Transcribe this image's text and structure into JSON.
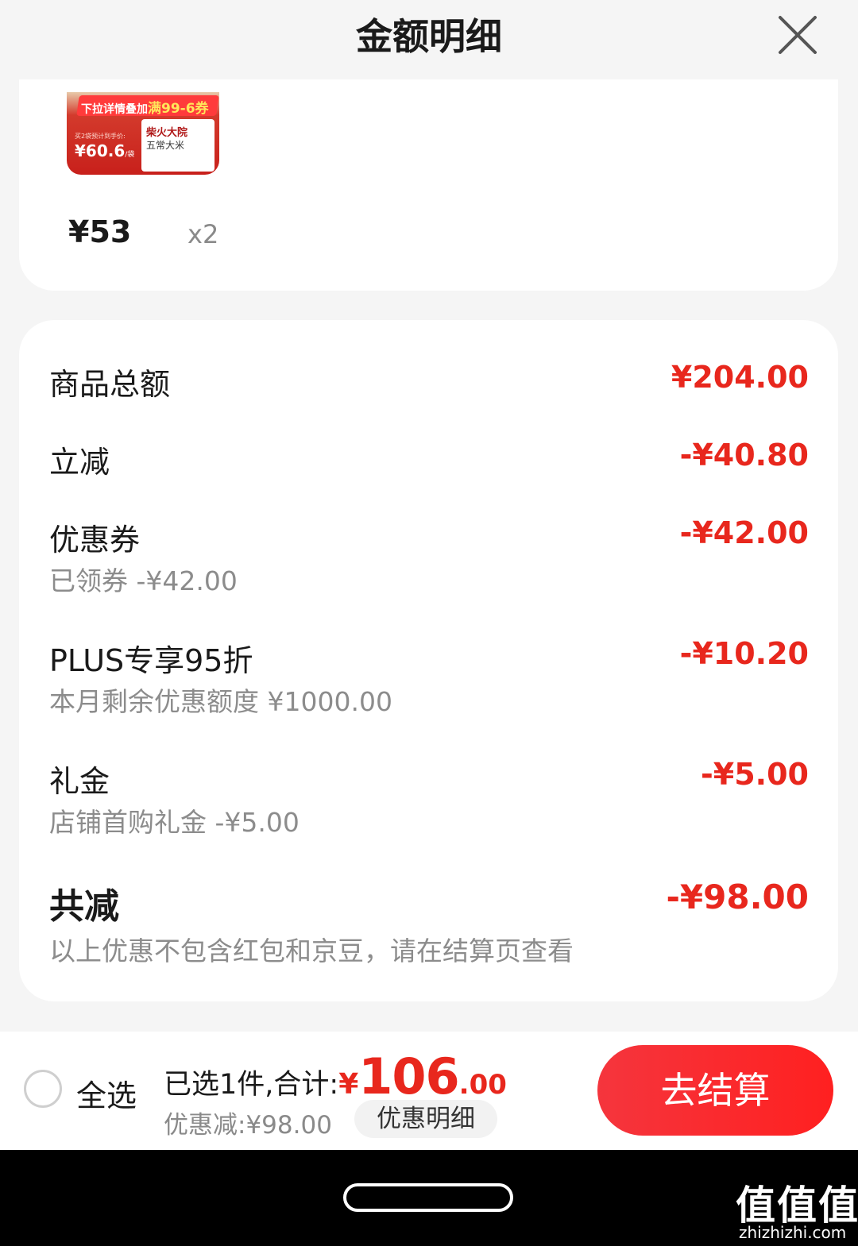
{
  "header": {
    "title": "金额明细",
    "close_icon": "close-icon"
  },
  "product": {
    "image": {
      "banner_prefix": "下拉详情叠加",
      "banner_highlight": "满99-6券",
      "box_brand": "柴火大院",
      "box_name": "五常大米",
      "small_text": "买2袋预计到手价:",
      "price_main": "¥60.6",
      "price_unit": "/袋"
    },
    "price": "¥53",
    "quantity": "x2"
  },
  "details": {
    "rows": [
      {
        "label": "商品总额",
        "value": "¥204.00",
        "sub": ""
      },
      {
        "label": "立减",
        "value": "-¥40.80",
        "sub": ""
      },
      {
        "label": "优惠券",
        "value": "-¥42.00",
        "sub": "已领券 -¥42.00"
      },
      {
        "label": "PLUS专享95折",
        "value": "-¥10.20",
        "sub": "本月剩余优惠额度 ¥1000.00"
      },
      {
        "label": "礼金",
        "value": "-¥5.00",
        "sub": "店铺首购礼金 -¥5.00"
      }
    ],
    "total": {
      "label": "共减",
      "value": "-¥98.00",
      "note": "以上优惠不包含红包和京豆，请在结算页查看"
    }
  },
  "bottom_bar": {
    "select_all": "全选",
    "summary_prefix": "已选1件,合计:",
    "currency": "¥",
    "total_int": "106",
    "total_dec": ".00",
    "discount": "优惠减:¥98.00",
    "detail_button": "优惠明细",
    "checkout_button": "去结算"
  },
  "watermark": {
    "logo": "值值值",
    "site": "zhizhizhi.com"
  },
  "colors": {
    "accent_red": "#e8271d",
    "background": "#f5f5f5",
    "muted_text": "#8c8c8c"
  }
}
